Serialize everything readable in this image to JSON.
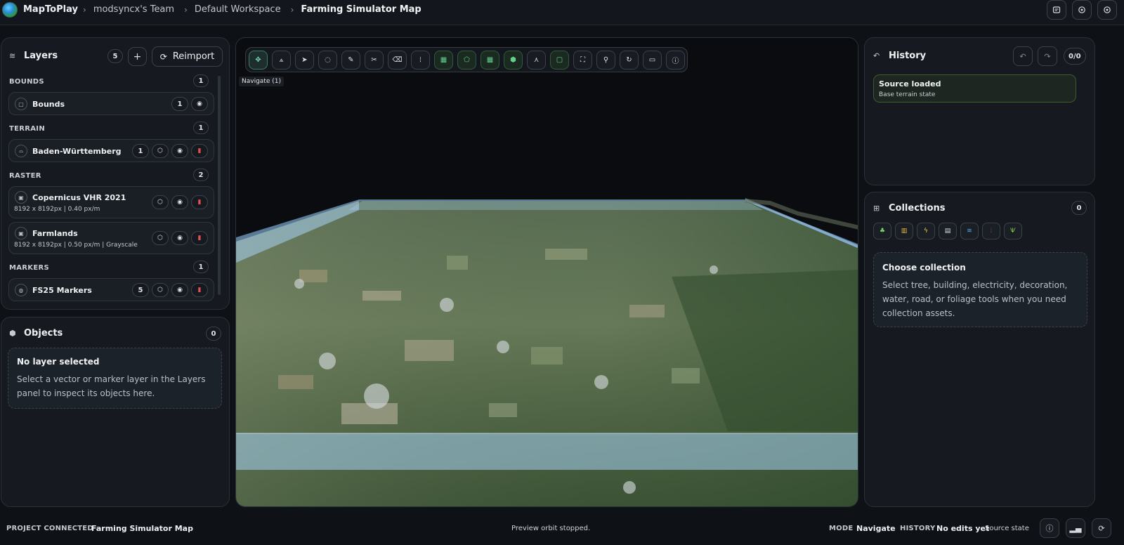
{
  "app": {
    "brand": "MapToPlay",
    "breadcrumbs": [
      "modsyncx's Team",
      "Default Workspace",
      "Farming Simulator Map"
    ]
  },
  "layers": {
    "title": "Layers",
    "count": "5",
    "add_label": "+",
    "reimport_label": "Reimport",
    "sections": {
      "bounds": {
        "label": "BOUNDS",
        "count": "1"
      },
      "terrain": {
        "label": "TERRAIN",
        "count": "1"
      },
      "raster": {
        "label": "RASTER",
        "count": "2"
      },
      "markers": {
        "label": "MARKERS",
        "count": "1"
      }
    },
    "items": [
      {
        "name": "Bounds",
        "count": "1"
      },
      {
        "name": "Baden-Württemberg",
        "count": "1"
      },
      {
        "name": "Copernicus VHR 2021",
        "sub": "8192 x 8192px | 0.40 px/m"
      },
      {
        "name": "Farmlands",
        "sub": "8192 x 8192px | 0.50 px/m | Grayscale"
      },
      {
        "name": "FS25 Markers",
        "count": "5"
      }
    ]
  },
  "objects": {
    "title": "Objects",
    "count": "0",
    "empty_title": "No layer selected",
    "empty_line1": "Select a vector or marker layer in the Layers",
    "empty_line2": "panel to inspect its objects here."
  },
  "viewport": {
    "tooltip": "Navigate (1)",
    "tools": [
      "move-tool",
      "draw-path-tool",
      "select-tool",
      "lasso-tool",
      "pencil-tool",
      "cut-tool",
      "eraser-tool",
      "measure-tool",
      "grid-tool",
      "polygon-tool",
      "table-tool",
      "object-tool",
      "branch-tool",
      "frame-tool",
      "focus-tool",
      "person-tool",
      "rotate-tool",
      "camera-tool",
      "info-tool"
    ]
  },
  "history": {
    "title": "History",
    "count": "0/0",
    "item_title": "Source loaded",
    "item_sub": "Base terrain state"
  },
  "collections": {
    "title": "Collections",
    "count": "0",
    "icon_colors": [
      "#7fd36b",
      "#e8b84a",
      "#e7d24a",
      "#d8dbe0",
      "#5aa8e8",
      "#e0605f",
      "#8fd24a"
    ],
    "empty_title": "Choose collection",
    "empty_line1": "Select tree, building, electricity, decoration,",
    "empty_line2": "water, road, or foliage tools when you need",
    "empty_line3": "collection assets."
  },
  "footer": {
    "project_label": "PROJECT CONNECTED",
    "project_name": "Farming Simulator Map",
    "status": "Preview orbit stopped.",
    "mode_label": "MODE",
    "mode_value": "Navigate",
    "history_label": "HISTORY",
    "history_value": "No edits yet",
    "history_sub": "Source state"
  }
}
